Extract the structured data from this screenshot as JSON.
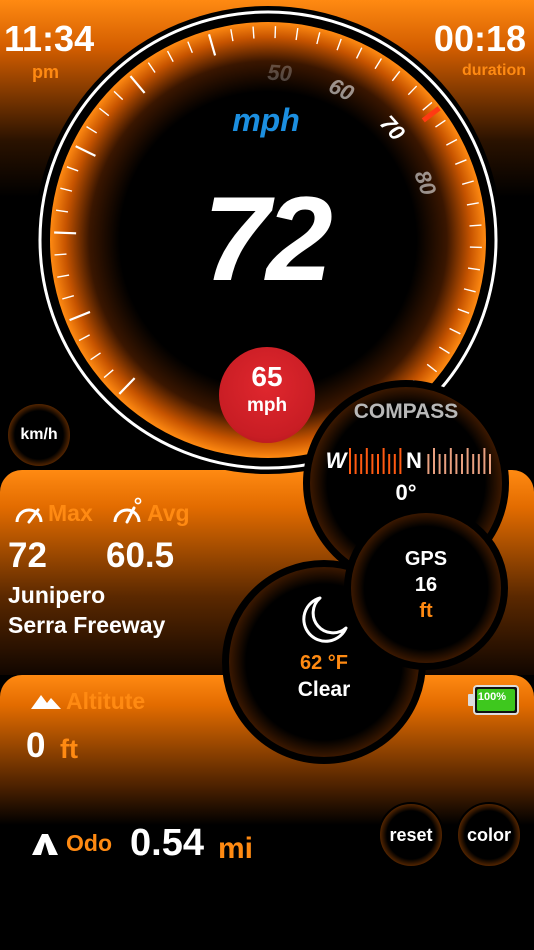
{
  "status": {
    "time": "11:34",
    "ampm": "pm",
    "duration": "00:18",
    "duration_label": "duration"
  },
  "speedometer": {
    "unit": "mph",
    "speed": "72",
    "needle_value": 72,
    "scale_labels": [
      "50",
      "60",
      "70",
      "80"
    ],
    "limit_value": "65",
    "limit_unit": "mph"
  },
  "buttons": {
    "units": "km/h",
    "reset": "reset",
    "color": "color"
  },
  "compass": {
    "title": "COMPASS",
    "west": "W",
    "north": "N",
    "heading": "0°"
  },
  "gps": {
    "title": "GPS",
    "accuracy": "16",
    "unit": "ft"
  },
  "weather": {
    "icon": "moon-icon",
    "temperature": "62 °F",
    "condition": "Clear"
  },
  "stats": {
    "max_label": "Max",
    "avg_label": "Avg",
    "max_value": "72",
    "avg_value": "60.5",
    "road_line1": "Junipero",
    "road_line2": "Serra Freeway"
  },
  "altitude": {
    "label": "Altitute",
    "value": "0",
    "unit": "ft"
  },
  "battery": {
    "text": "100%",
    "level": 1.0
  },
  "odometer": {
    "label": "Odo",
    "value": "0.54",
    "unit": "mi"
  },
  "colors": {
    "accent": "#ff8a12",
    "speed_unit": "#1c8fe0",
    "limit_red": "#c81d24",
    "battery_green": "#3ec81e"
  }
}
